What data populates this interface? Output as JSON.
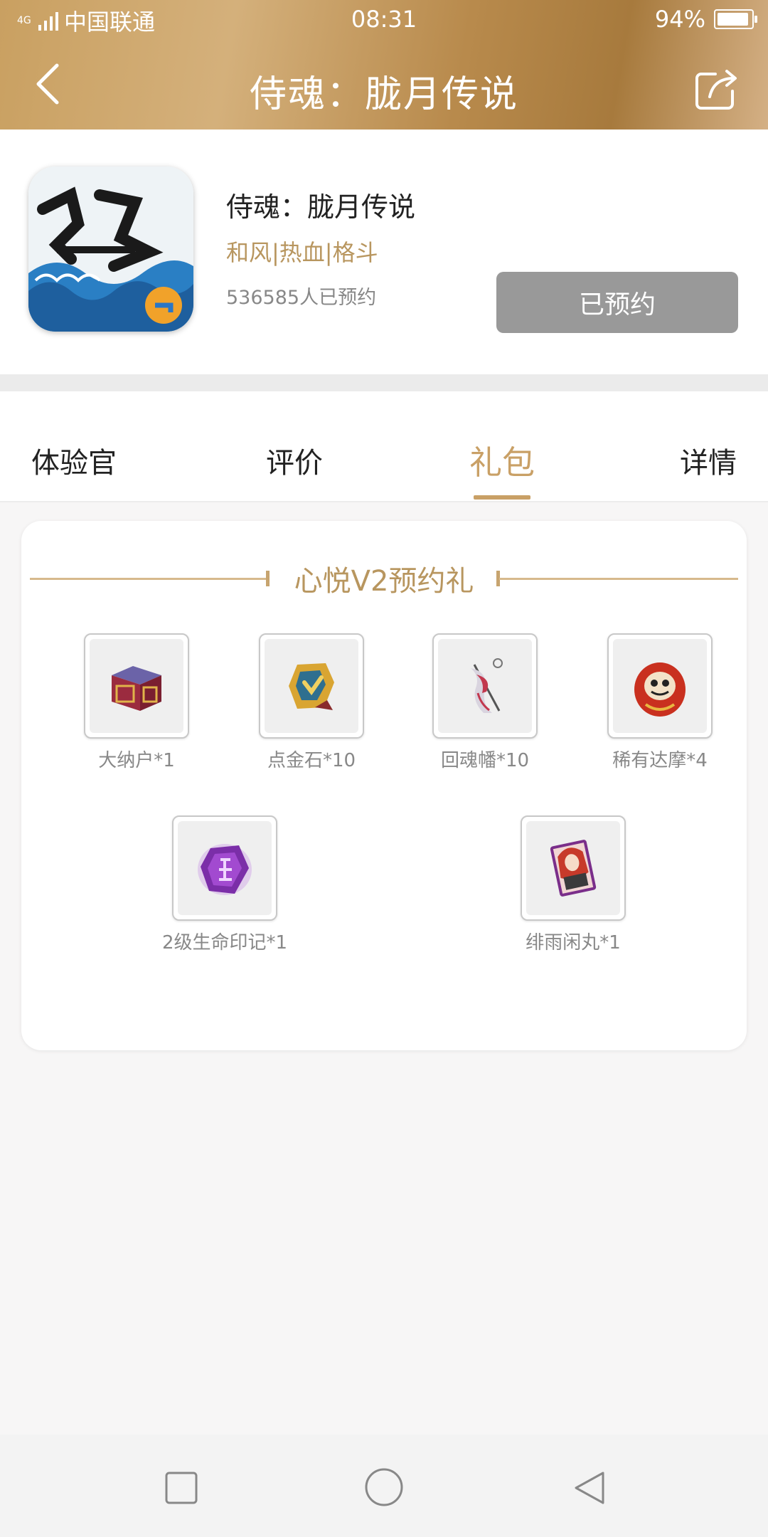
{
  "status_bar": {
    "network_type": "4G",
    "carrier": "中国联通",
    "time": "08:31",
    "battery_percent": "94%",
    "battery_level": 0.94
  },
  "nav": {
    "title": "侍魂：胧月传说",
    "back_icon": "chevron-left-icon",
    "share_icon": "share-icon"
  },
  "app": {
    "name": "侍魂：胧月传说",
    "tags": "和风|热血|格斗",
    "reserve_count": "536585人已预约",
    "reserve_button": "已预约"
  },
  "tabs": [
    {
      "label": "体验官",
      "active": false
    },
    {
      "label": "评价",
      "active": false
    },
    {
      "label": "礼包",
      "active": true
    },
    {
      "label": "详情",
      "active": false
    }
  ],
  "gift": {
    "title": "心悦V2预约礼",
    "items": [
      {
        "label": "大纳户*1",
        "icon": "chest-icon"
      },
      {
        "label": "点金石*10",
        "icon": "gold-stone-icon"
      },
      {
        "label": "回魂幡*10",
        "icon": "banner-icon"
      },
      {
        "label": "稀有达摩*4",
        "icon": "daruma-icon"
      },
      {
        "label": "2级生命印记*1",
        "icon": "purple-crystal-icon"
      },
      {
        "label": "绯雨闲丸*1",
        "icon": "character-card-icon"
      }
    ]
  },
  "colors": {
    "accent_gold": "#c9a066",
    "header_gradient": [
      "#c9a061",
      "#a77a3d"
    ],
    "button_disabled": "#999999"
  }
}
